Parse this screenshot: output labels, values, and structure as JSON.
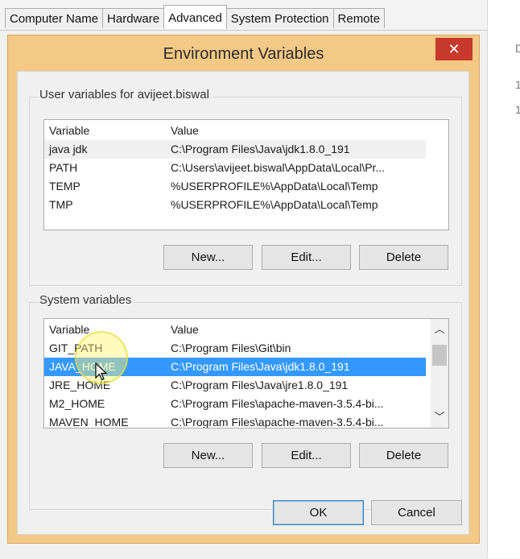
{
  "tabs": [
    {
      "label": "Computer Name"
    },
    {
      "label": "Hardware"
    },
    {
      "label": "Advanced"
    },
    {
      "label": "System Protection"
    },
    {
      "label": "Remote"
    }
  ],
  "background_right": {
    "items": [
      "D",
      "1",
      "1"
    ]
  },
  "dialog": {
    "title": "Environment Variables",
    "close_glyph": "✕",
    "user_group": {
      "label": "User variables for avijeet.biswal",
      "columns": [
        "Variable",
        "Value"
      ],
      "rows": [
        {
          "variable": "java jdk",
          "value": "C:\\Program Files\\Java\\jdk1.8.0_191"
        },
        {
          "variable": "PATH",
          "value": "C:\\Users\\avijeet.biswal\\AppData\\Local\\Pr..."
        },
        {
          "variable": "TEMP",
          "value": "%USERPROFILE%\\AppData\\Local\\Temp"
        },
        {
          "variable": "TMP",
          "value": "%USERPROFILE%\\AppData\\Local\\Temp"
        }
      ],
      "buttons": {
        "new": "New...",
        "edit": "Edit...",
        "delete": "Delete"
      }
    },
    "system_group": {
      "label": "System variables",
      "columns": [
        "Variable",
        "Value"
      ],
      "rows": [
        {
          "variable": "GIT_PATH",
          "value": "C:\\Program Files\\Git\\bin"
        },
        {
          "variable": "JAVA_HOME",
          "value": "C:\\Program Files\\Java\\jdk1.8.0_191"
        },
        {
          "variable": "JRE_HOME",
          "value": "C:\\Program Files\\Java\\jre1.8.0_191"
        },
        {
          "variable": "M2_HOME",
          "value": "C:\\Program Files\\apache-maven-3.5.4-bi..."
        },
        {
          "variable": "MAVEN_HOME",
          "value": "C:\\Program Files\\apache-maven-3.5.4-bi..."
        }
      ],
      "scroll_up": "︿",
      "scroll_down": "﹀",
      "buttons": {
        "new": "New...",
        "edit": "Edit...",
        "delete": "Delete"
      }
    },
    "ok_label": "OK",
    "cancel_label": "Cancel"
  },
  "colors": {
    "title_bar": "#f4c985",
    "close_button": "#c7392c",
    "selection": "#3399ff"
  }
}
